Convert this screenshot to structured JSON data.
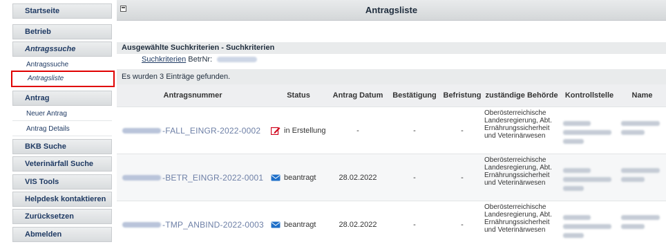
{
  "sidebar": {
    "items": [
      {
        "label": "Startseite",
        "type": "main"
      },
      {
        "label": "Betrieb",
        "type": "main"
      },
      {
        "label": "Antragssuche",
        "type": "main-italic"
      },
      {
        "label": "Antragssuche",
        "type": "sub"
      },
      {
        "label": "Antragsliste",
        "type": "sub-active"
      },
      {
        "label": "Antrag",
        "type": "main"
      },
      {
        "label": "Neuer Antrag",
        "type": "sub"
      },
      {
        "label": "Antrag Details",
        "type": "sub"
      },
      {
        "label": "BKB Suche",
        "type": "main"
      },
      {
        "label": "Veterinärfall Suche",
        "type": "main"
      },
      {
        "label": "VIS Tools",
        "type": "main"
      },
      {
        "label": "Helpdesk kontaktieren",
        "type": "main"
      },
      {
        "label": "Zurücksetzen",
        "type": "main"
      },
      {
        "label": "Abmelden",
        "type": "main"
      }
    ]
  },
  "header": {
    "title": "Antragsliste"
  },
  "criteria": {
    "heading": "Ausgewählte Suchkriterien - Suchkriterien",
    "link_label": "Suchkriterien",
    "field_label": "BetrNr:"
  },
  "results": {
    "message": "Es wurden 3 Einträge gefunden."
  },
  "table": {
    "columns": [
      "Antragsnummer",
      "Status",
      "Antrag Datum",
      "Bestätigung",
      "Befristung",
      "zuständige Behörde",
      "Kontrollstelle",
      "Name"
    ],
    "rows": [
      {
        "antragsnummer": "-FALL_EINGR-2022-0002",
        "status": "in Erstellung",
        "status_icon": "edit-icon",
        "datum": "-",
        "bestaetigung": "-",
        "befristung": "-",
        "behoerde": "Oberösterreichische Landesregierung, Abt. Ernährungssicherheit und Veterinärwesen"
      },
      {
        "antragsnummer": "-BETR_EINGR-2022-0001",
        "status": "beantragt",
        "status_icon": "envelope-icon",
        "datum": "28.02.2022",
        "bestaetigung": "-",
        "befristung": "-",
        "behoerde": "Oberösterreichische Landesregierung, Abt. Ernährungssicherheit und Veterinärwesen"
      },
      {
        "antragsnummer": "-TMP_ANBIND-2022-0003",
        "status": "beantragt",
        "status_icon": "envelope-icon",
        "datum": "28.02.2022",
        "bestaetigung": "-",
        "befristung": "-",
        "behoerde": "Oberösterreichische Landesregierung, Abt. Ernährungssicherheit und Veterinärwesen"
      }
    ]
  },
  "colors": {
    "accent": "#1f3a63",
    "highlight": "#e00000",
    "edit_icon": "#d0021b",
    "mail_icon": "#1e6fc8"
  }
}
